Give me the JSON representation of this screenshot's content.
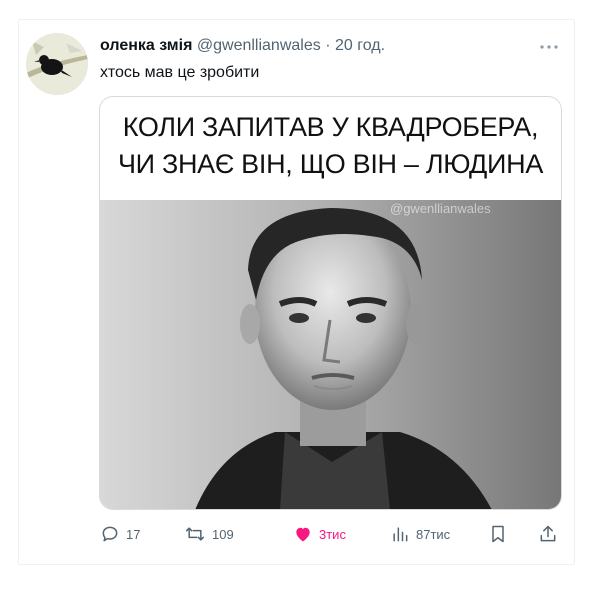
{
  "tweet": {
    "author_name": "оленка змія",
    "handle": "@gwenllianwales",
    "separator": "·",
    "time": "20 год.",
    "text": "хтось мав це зробити",
    "more_icon": "more-horizontal-icon"
  },
  "media": {
    "caption_line1": "КОЛИ ЗАПИТАВ У КВАДРОБЕРА,",
    "caption_line2": "ЧИ ЗНАЄ ВІН, ЩО ВІН – ЛЮДИНА",
    "watermark": "@gwenllianwales"
  },
  "actions": {
    "replies": "17",
    "retweets": "109",
    "likes": "3тис",
    "views": "87тис",
    "like_color": "#f91880",
    "icon_color": "#536471"
  }
}
